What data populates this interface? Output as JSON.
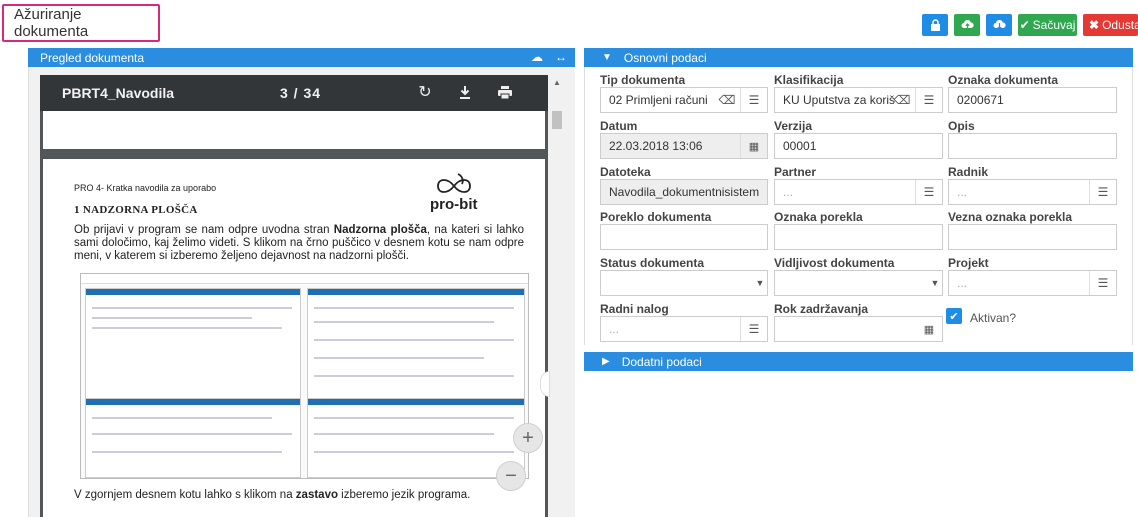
{
  "page_title": "Ažuriranje dokumenta",
  "toolbar": {
    "lock_icon": "lock-icon",
    "save_label": "Sačuvaj",
    "cancel_label": "Odustani"
  },
  "left_panel": {
    "title": "Pregled dokumenta",
    "viewer": {
      "doc_name": "PBRT4_Navodila",
      "page_indicator": "3 / 34"
    },
    "document": {
      "small_heading": "PRO 4- Kratka navodila za uporabo",
      "section_heading": "1   NADZORNA PLOŠČA",
      "paragraph_pre": "Ob prijavi v program se nam odpre uvodna stran ",
      "paragraph_bold": "Nadzorna plošča",
      "paragraph_post": ", na kateri si lahko sami določimo, kaj želimo videti. S klikom na črno puščico v desnem kotu se nam odpre meni, v katerem si izberemo željeno dejavnost na nadzorni plošči.",
      "footer_pre": "V zgornjem desnem kotu lahko s klikom na ",
      "footer_bold": "zastavo",
      "footer_post": " izberemo jezik programa.",
      "logo_text": "pro-bit"
    }
  },
  "right_panel": {
    "section_title": "Osnovni podaci",
    "section2_title": "Dodatni podaci",
    "fields": {
      "tip_dokumenta": {
        "label": "Tip dokumenta",
        "value": "02 Primljeni računi"
      },
      "klasifikacija": {
        "label": "Klasifikacija",
        "value": "KU Uputstva za koriš"
      },
      "oznaka_dokumenta": {
        "label": "Oznaka dokumenta",
        "value": "0200671"
      },
      "datum": {
        "label": "Datum",
        "value": "22.03.2018 13:06"
      },
      "verzija": {
        "label": "Verzija",
        "value": "00001"
      },
      "opis": {
        "label": "Opis",
        "value": ""
      },
      "datoteka": {
        "label": "Datoteka",
        "value": "Navodila_dokumentnisistem"
      },
      "partner": {
        "label": "Partner",
        "placeholder": "..."
      },
      "radnik": {
        "label": "Radnik",
        "placeholder": "..."
      },
      "poreklo_dokumenta": {
        "label": "Poreklo dokumenta",
        "value": ""
      },
      "oznaka_porekla": {
        "label": "Oznaka porekla",
        "value": ""
      },
      "vezna_oznaka_porekla": {
        "label": "Vezna oznaka porekla",
        "value": ""
      },
      "status_dokumenta": {
        "label": "Status dokumenta",
        "value": ""
      },
      "vidljivost_dokumenta": {
        "label": "Vidljivost dokumenta",
        "value": ""
      },
      "projekt": {
        "label": "Projekt",
        "placeholder": "..."
      },
      "radni_nalog": {
        "label": "Radni nalog",
        "placeholder": "..."
      },
      "rok_zadrzavanja": {
        "label": "Rok zadržavanja",
        "value": ""
      },
      "aktivan": {
        "label": "Aktivan?",
        "checked": true
      }
    }
  },
  "colors": {
    "primary": "#2a8de0",
    "success": "#2fa84f",
    "danger": "#e53935",
    "title_border": "#d6297a"
  }
}
